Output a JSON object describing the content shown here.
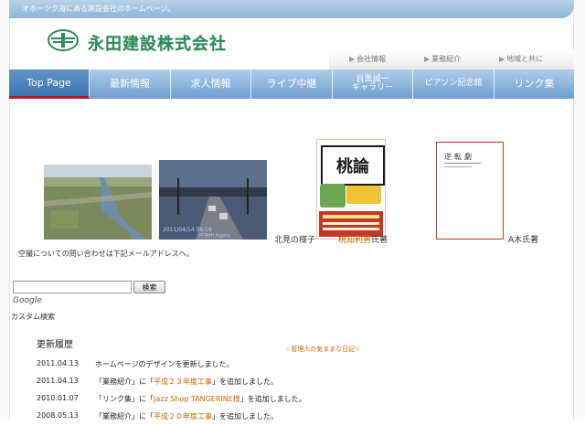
{
  "header": {
    "tagline": "オホーツク海にある建設会社のホームページ。",
    "company_name": "永田建設株式会社",
    "logo_icon": "company-logo-icon"
  },
  "subnav": {
    "items": [
      {
        "label": "会社情報"
      },
      {
        "label": "業務紹介"
      },
      {
        "label": "地域と共に"
      }
    ]
  },
  "nav": {
    "items": [
      {
        "label": "Top Page",
        "active": true
      },
      {
        "label": "最新情報"
      },
      {
        "label": "求人情報"
      },
      {
        "label": "ライブ中継"
      },
      {
        "label": "目黒誠一\nギャラリー"
      },
      {
        "label": "ピアソン記念館"
      },
      {
        "label": "リンク集"
      }
    ]
  },
  "photos": {
    "river_alt": "river photo",
    "street_timestamp": "2011/04/14 06:56",
    "street_watermark": "PITAHI Ingata\nConstruction, LTD",
    "book1_title": "桃論",
    "book1_subtitle": "中小建設業サバイバル論",
    "book2_title": "逆転劇",
    "caption_kitami": "北見の様子",
    "caption_momochi_name": "桃知利男",
    "caption_momochi_suffix": "氏著",
    "caption_aoki": "A木氏著"
  },
  "contact": {
    "text": "空撮についての問い合わせは下記メールアドレスへ。"
  },
  "search": {
    "button_label": "検索",
    "google_label": "Google",
    "custom_label": "カスタム検索",
    "value": ""
  },
  "updates": {
    "title": "更新履歴",
    "diary_link": "☆管理人の気ままな日記☆",
    "items": [
      {
        "date": "2011.04.13",
        "pre": "ホームページのデザインを更新しました。",
        "link": "",
        "post": ""
      },
      {
        "date": "2011.04.13",
        "pre": "「業務紹介」に「",
        "link": "平成２３年度工事",
        "post": "」を追加しました。"
      },
      {
        "date": "2010.01.07",
        "pre": "「リンク集」に「",
        "link": "Jazz Shop TANGERINE様",
        "post": "」を追加しました。"
      },
      {
        "date": "2008.05.13",
        "pre": "「業務紹介」に「",
        "link": "平成２０年度工事",
        "post": "」を追加しました。"
      }
    ]
  },
  "colors": {
    "accent": "#6d9fcf",
    "brand_green": "#2e8b57",
    "active_underline": "#b2182b",
    "link_orange": "#cc6600"
  }
}
